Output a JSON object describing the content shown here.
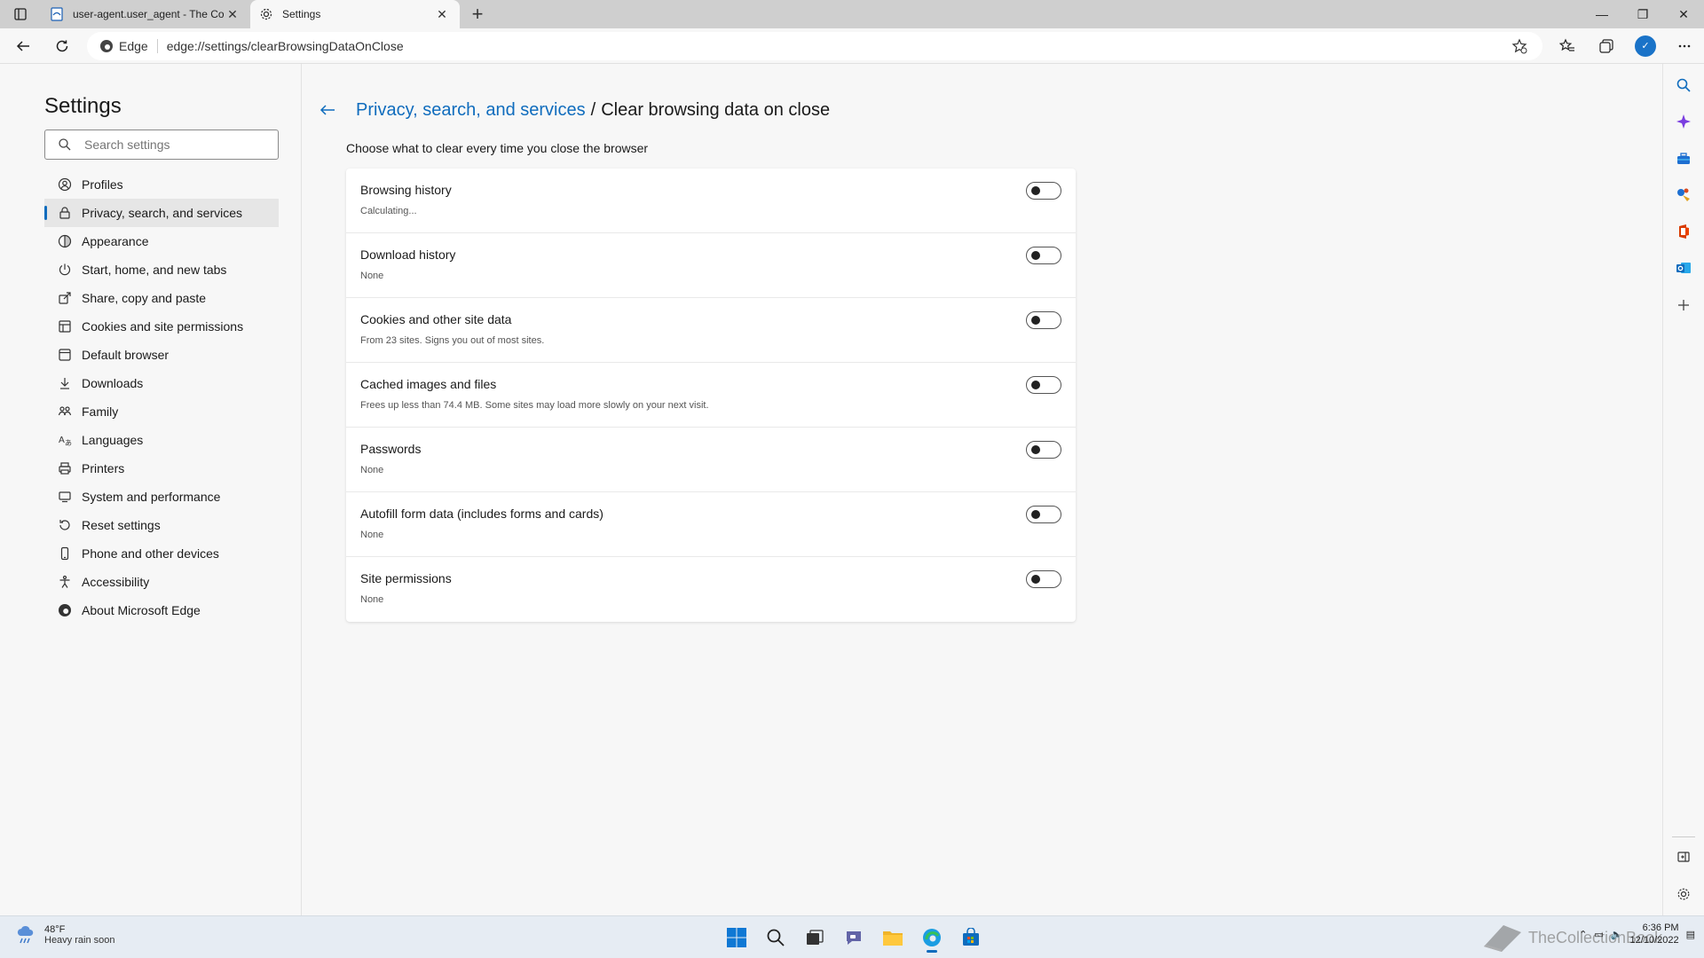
{
  "tabs": [
    {
      "title": "user-agent.user_agent - The Coll",
      "active": false
    },
    {
      "title": "Settings",
      "active": true
    }
  ],
  "toolbar": {
    "site_label": "Edge",
    "url": "edge://settings/clearBrowsingDataOnClose"
  },
  "settings_nav": {
    "title": "Settings",
    "search_placeholder": "Search settings",
    "items": [
      {
        "label": "Profiles",
        "icon": "profile-icon"
      },
      {
        "label": "Privacy, search, and services",
        "icon": "lock-icon",
        "selected": true
      },
      {
        "label": "Appearance",
        "icon": "appearance-icon"
      },
      {
        "label": "Start, home, and new tabs",
        "icon": "power-icon"
      },
      {
        "label": "Share, copy and paste",
        "icon": "share-icon"
      },
      {
        "label": "Cookies and site permissions",
        "icon": "cookie-permissions-icon"
      },
      {
        "label": "Default browser",
        "icon": "browser-icon"
      },
      {
        "label": "Downloads",
        "icon": "download-icon"
      },
      {
        "label": "Family",
        "icon": "family-icon"
      },
      {
        "label": "Languages",
        "icon": "language-icon"
      },
      {
        "label": "Printers",
        "icon": "printer-icon"
      },
      {
        "label": "System and performance",
        "icon": "computer-icon"
      },
      {
        "label": "Reset settings",
        "icon": "reset-icon"
      },
      {
        "label": "Phone and other devices",
        "icon": "phone-icon"
      },
      {
        "label": "Accessibility",
        "icon": "accessibility-icon"
      },
      {
        "label": "About Microsoft Edge",
        "icon": "edge-logo-icon"
      }
    ]
  },
  "main": {
    "breadcrumb_parent": "Privacy, search, and services",
    "breadcrumb_separator": "/",
    "breadcrumb_current": "Clear browsing data on close",
    "subtitle": "Choose what to clear every time you close the browser",
    "options": [
      {
        "label": "Browsing history",
        "description": "Calculating...",
        "enabled": false
      },
      {
        "label": "Download history",
        "description": "None",
        "enabled": false
      },
      {
        "label": "Cookies and other site data",
        "description": "From 23 sites. Signs you out of most sites.",
        "enabled": false
      },
      {
        "label": "Cached images and files",
        "description": "Frees up less than 74.4 MB. Some sites may load more slowly on your next visit.",
        "enabled": false
      },
      {
        "label": "Passwords",
        "description": "None",
        "enabled": false
      },
      {
        "label": "Autofill form data (includes forms and cards)",
        "description": "None",
        "enabled": false
      },
      {
        "label": "Site permissions",
        "description": "None",
        "enabled": false
      }
    ]
  },
  "taskbar": {
    "weather_temp": "48°F",
    "weather_condition": "Heavy rain soon",
    "time": "6:36 PM",
    "date": "12/10/2022",
    "watermark": "TheCollectionBook"
  },
  "colors": {
    "accent": "#0f6cbd",
    "background": "#f7f7f7",
    "card": "#ffffff"
  }
}
